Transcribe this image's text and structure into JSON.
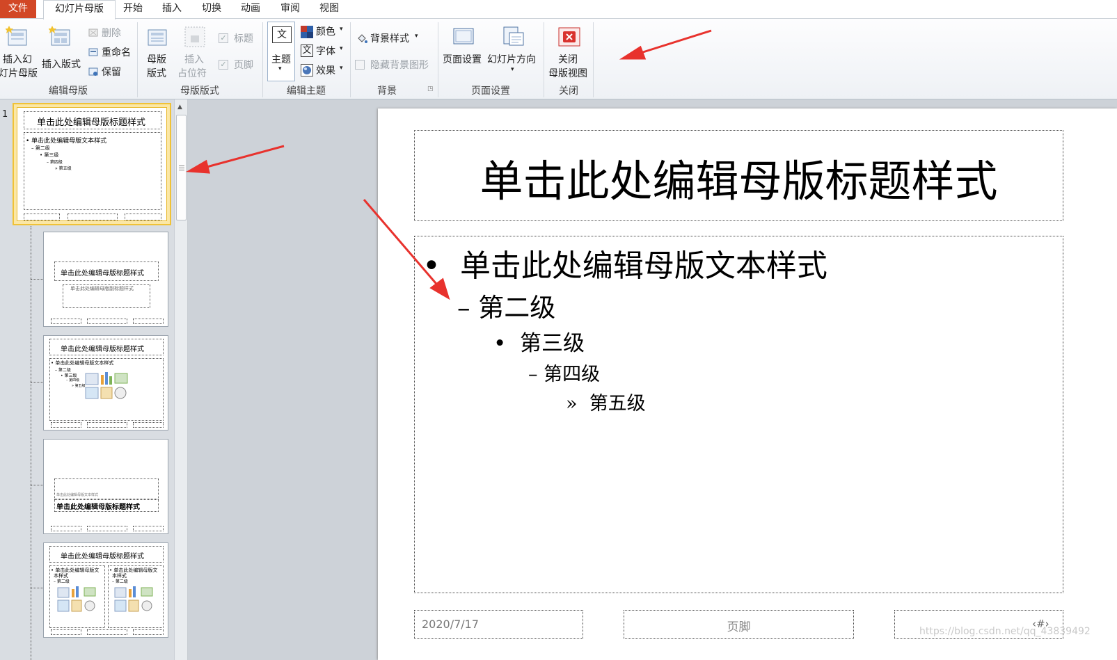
{
  "tabs": {
    "file": "文件",
    "items": [
      "幻灯片母版",
      "开始",
      "插入",
      "切换",
      "动画",
      "审阅",
      "视图"
    ]
  },
  "ribbon": {
    "edit_master": {
      "group_label": "编辑母版",
      "insert_slide_master": [
        "插入幻",
        "灯片母版"
      ],
      "insert_layout": "插入版式",
      "delete": "删除",
      "rename": "重命名",
      "preserve": "保留"
    },
    "master_layout": {
      "group_label": "母版版式",
      "master_layout_btn": [
        "母版",
        "版式"
      ],
      "insert_placeholder": [
        "插入",
        "占位符"
      ],
      "title_check": "标题",
      "footer_check": "页脚"
    },
    "edit_theme": {
      "group_label": "编辑主题",
      "themes": "主题",
      "colors": "颜色",
      "fonts": "字体",
      "effects": "效果"
    },
    "background": {
      "group_label": "背景",
      "styles": "背景样式",
      "hide_graphics": "隐藏背景图形"
    },
    "page_setup": {
      "group_label": "页面设置",
      "setup": "页面设置",
      "orientation": "幻灯片方向"
    },
    "close": {
      "group_label": "关闭",
      "close_btn": [
        "关闭",
        "母版视图"
      ]
    }
  },
  "thumbnails": {
    "number": "1",
    "title_text": "单击此处编辑母版标题样式",
    "body_text": "单击此处编辑母版文本样式",
    "subtitle_text": "单击此处编辑母版副标题样式",
    "small_text": "单击此处编辑母版文本样式",
    "levels": [
      "第二级",
      "第三级",
      "第四级",
      "第五级"
    ],
    "two_col_text": [
      "单击此处编辑母版文",
      "本样式"
    ]
  },
  "slide": {
    "title": "单击此处编辑母版标题样式",
    "level1": "单击此处编辑母版文本样式",
    "level2": "第二级",
    "level3": "第三级",
    "level4": "第四级",
    "level5": "第五级",
    "date": "2020/7/17",
    "footer": "页脚",
    "page_number": "‹#›",
    "watermark": "https://blog.csdn.net/qq_43839492"
  },
  "colors": {
    "file_tab": "#d24726",
    "annotation_arrow": "#e8322d",
    "selected_thumb": "#f5c842"
  }
}
